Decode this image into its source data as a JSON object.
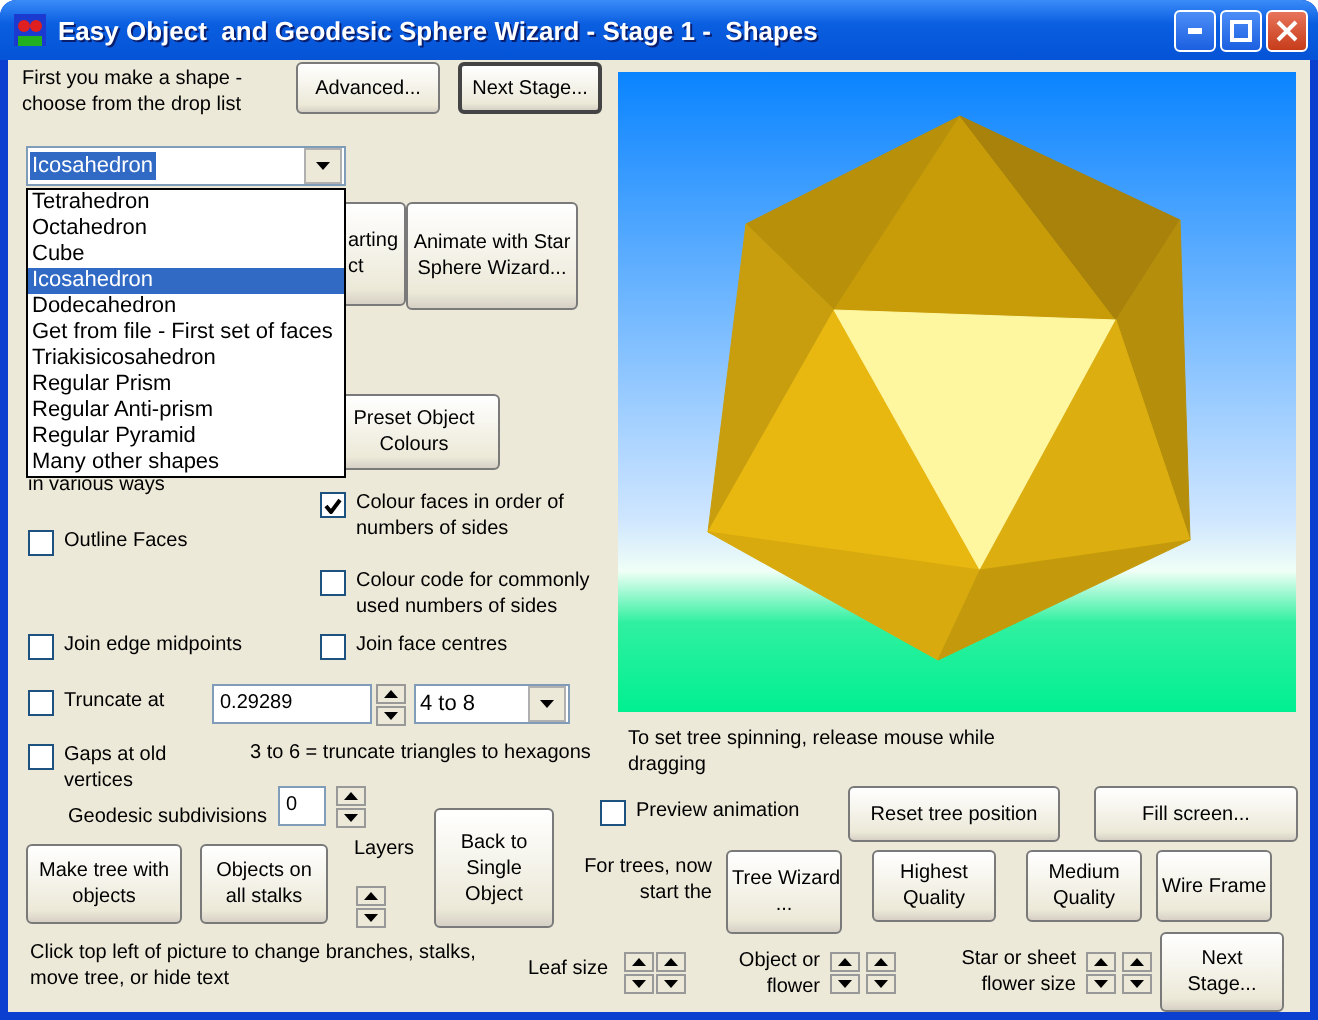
{
  "window": {
    "title": "Easy Object  and Geodesic Sphere Wizard - Stage 1 -  Shapes"
  },
  "controls": [
    {
      "kind": "label",
      "text": "First you make a shape -\nchoose from the drop list"
    },
    {
      "kind": "button",
      "text": "Advanced..."
    },
    {
      "kind": "default_button",
      "text": "Next Stage..."
    },
    {
      "kind": "combo",
      "value": "Icosahedron",
      "focused": true
    },
    {
      "kind": "button",
      "text": "arting\nct"
    },
    {
      "kind": "button",
      "text": "Animate with Star\nSphere Wizard..."
    },
    {
      "kind": "button",
      "text": "Preset Object\nColours"
    },
    {
      "kind": "label",
      "text": "in various ways"
    },
    {
      "kind": "checkbox",
      "text": "Colour faces in order of\nnumbers of sides",
      "checked": true
    },
    {
      "kind": "checkbox",
      "text": "Outline Faces",
      "checked": false
    },
    {
      "kind": "checkbox",
      "text": "Colour code for commonly\nused numbers of sides",
      "checked": false
    },
    {
      "kind": "checkbox",
      "text": "Join edge midpoints",
      "checked": false
    },
    {
      "kind": "checkbox",
      "text": "Join face centres",
      "checked": false
    },
    {
      "kind": "checkbox",
      "text": "Truncate at",
      "checked": false
    },
    {
      "kind": "field",
      "value": "0.29289"
    },
    {
      "kind": "combo",
      "value": "4 to 8",
      "focused": false
    },
    {
      "kind": "checkbox",
      "text": "Gaps at old\nvertices",
      "checked": false
    },
    {
      "kind": "label",
      "text": "3 to 6 = truncate triangles to hexagons"
    },
    {
      "kind": "label",
      "text": "Geodesic subdivisions"
    },
    {
      "kind": "field",
      "value": "0"
    },
    {
      "kind": "label",
      "text": "Layers"
    },
    {
      "kind": "button",
      "text": "Make tree with\nobjects"
    },
    {
      "kind": "button",
      "text": "Objects on\nall stalks"
    },
    {
      "kind": "button",
      "text": "Back to\nSingle\nObject"
    },
    {
      "kind": "label",
      "text": "Click top left of picture to change branches, stalks,\nmove tree, or hide text"
    },
    {
      "kind": "label",
      "text": "Leaf size"
    },
    {
      "kind": "label",
      "text": "To set tree spinning, release mouse while\ndragging"
    },
    {
      "kind": "checkbox",
      "text": "Preview animation",
      "checked": false
    },
    {
      "kind": "button",
      "text": "Reset tree position"
    },
    {
      "kind": "button",
      "text": "Fill screen..."
    },
    {
      "kind": "label_right",
      "text": "For trees, now\nstart the"
    },
    {
      "kind": "button",
      "text": "Tree Wizard\n..."
    },
    {
      "kind": "button",
      "text": "Highest\nQuality"
    },
    {
      "kind": "button",
      "text": "Medium\nQuality"
    },
    {
      "kind": "button",
      "text": "Wire Frame"
    },
    {
      "kind": "label_right",
      "text": "Object or\nflower"
    },
    {
      "kind": "label_right",
      "text": "Star or sheet\nflower size"
    },
    {
      "kind": "button",
      "text": "Next\nStage..."
    }
  ],
  "shape_list": {
    "items": [
      {
        "label": "Tetrahedron",
        "selected": false
      },
      {
        "label": "Octahedron",
        "selected": false
      },
      {
        "label": "Cube",
        "selected": false
      },
      {
        "label": "Icosahedron",
        "selected": true
      },
      {
        "label": "Dodecahedron",
        "selected": false
      },
      {
        "label": "Get from file - First set of faces",
        "selected": false
      },
      {
        "label": "Triakisicosahedron",
        "selected": false
      },
      {
        "label": "Regular Prism",
        "selected": false
      },
      {
        "label": "Regular Anti-prism",
        "selected": false
      },
      {
        "label": "Regular Pyramid",
        "selected": false
      },
      {
        "label": "Many other shapes",
        "selected": false
      }
    ]
  }
}
